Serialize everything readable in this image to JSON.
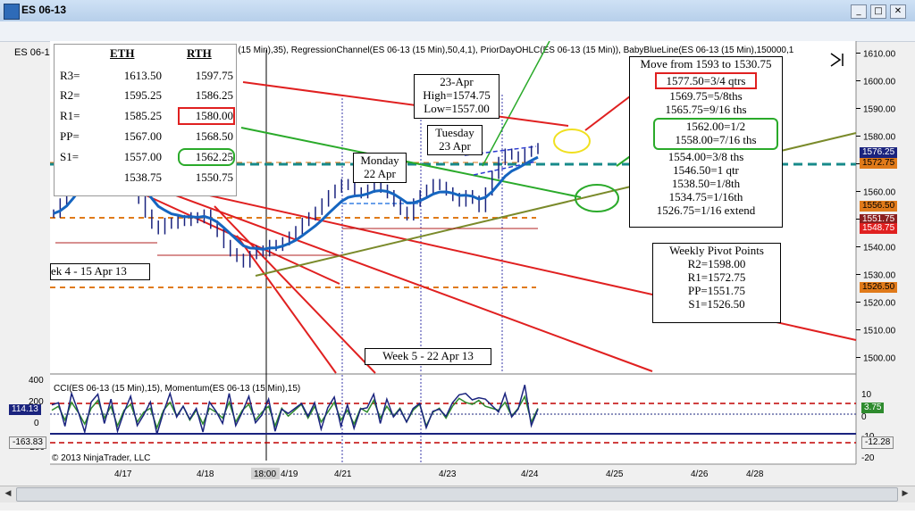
{
  "window": {
    "title": "ES 06-13",
    "instrument": "ES 06-1",
    "minimize_glyph": "_",
    "maximize_glyph": "□",
    "close_glyph": "✕"
  },
  "indicator_bar": {
    "text": "3 (15 Min),35), RegressionChannel(ES 06-13 (15 Min),50,4,1), PriorDayOHLC(ES 06-13 (15 Min)), BabyBlueLine(ES 06-13 (15 Min),150000,1"
  },
  "pivot_table": {
    "col_eth": "ETH",
    "col_rth": "RTH",
    "rows": [
      {
        "label": "R3=",
        "eth": "1613.50",
        "rth": "1597.75"
      },
      {
        "label": "R2=",
        "eth": "1595.25",
        "rth": "1586.25"
      },
      {
        "label": "R1=",
        "eth": "1585.25",
        "rth": "1580.00"
      },
      {
        "label": "PP=",
        "eth": "1567.00",
        "rth": "1568.50"
      },
      {
        "label": "S1=",
        "eth": "1557.00",
        "rth": "1562.25"
      },
      {
        "label": "",
        "eth": "1538.75",
        "rth": "1550.75"
      }
    ]
  },
  "annotations": {
    "apr23": [
      "23-Apr",
      "High=1574.75",
      "Low=1557.00"
    ],
    "tuesday": [
      "Tuesday",
      "23 Apr"
    ],
    "monday": [
      "Monday",
      "22 Apr"
    ],
    "week4": "ek 4 - 15 Apr 13",
    "week5": "Week 5 - 22 Apr 13",
    "move": {
      "title": "Move from 1593 to 1530.75",
      "lines": [
        "1577.50=3/4 qtrs",
        "1569.75=5/8ths",
        "1565.75=9/16 ths",
        "1562.00=1/2",
        "1558.00=7/16 ths",
        "1554.00=3/8 ths",
        "1546.50=1 qtr",
        "1538.50=1/8th",
        "1534.75=1/16th",
        "1526.75=1/16 extend"
      ]
    },
    "weekly_pivots": [
      "Weekly Pivot Points",
      "R2=1598.00",
      "R1=1572.75",
      "PP=1551.75",
      "S1=1526.50"
    ]
  },
  "price_tags": {
    "t1": "1576.25",
    "t2": "1572.75",
    "t3": "1556.50",
    "t4": "1551.75",
    "t5": "1548.75",
    "t6": "1526.50"
  },
  "lower_panel": {
    "label": "CCI(ES 06-13 (15 Min),15), Momentum(ES 06-13 (15 Min),15)",
    "copyright": "© 2013 NinjaTrader, LLC",
    "left_value_1": "114.13",
    "left_value_2": "-163.83",
    "right_value_1": "3.75",
    "right_value_2": "-12.28",
    "left_ticks": [
      "400",
      "200",
      "0",
      "-200"
    ],
    "right_ticks": [
      "10",
      "0",
      "-10",
      "-20"
    ]
  },
  "chart_data": {
    "type": "line",
    "y_axis_ticks": [
      1610,
      1600,
      1590,
      1580,
      1570,
      1560,
      1550,
      1540,
      1530,
      1520,
      1510,
      1500
    ],
    "ylim": [
      1495,
      1615
    ],
    "x_ticks": [
      "4/17",
      "4/18",
      "18:00",
      "4/19",
      "4/21",
      "4/23",
      "4/24",
      "4/25",
      "4/26",
      "4/28"
    ],
    "colors": {
      "price": "#1a237e",
      "ma": "#1565c0",
      "red_lines": "#e02020",
      "green_lines": "#2aaa2a",
      "olive": "#7a8a2a",
      "orange": "#e07a1a",
      "teal": "#178a8a"
    },
    "price_series": [
      [
        1552,
        1556,
        1560,
        1566,
        1570,
        1573,
        1571,
        1569,
        1572,
        1570,
        1567,
        1565,
        1561,
        1557,
        1552,
        1548,
        1546,
        1549,
        1548,
        1550,
        1549,
        1551,
        1550,
        1552,
        1548,
        1545,
        1541,
        1538,
        1536,
        1534,
        1537,
        1539,
        1538,
        1541,
        1540,
        1542,
        1544,
        1546,
        1549,
        1551,
        1553,
        1556,
        1559,
        1561,
        1563,
        1562,
        1560,
        1559,
        1561,
        1563,
        1561,
        1559,
        1556,
        1553,
        1551,
        1556,
        1559,
        1561,
        1563,
        1562,
        1560,
        1558,
        1556,
        1559,
        1557,
        1554,
        1560,
        1566,
        1571,
        1574,
        1573,
        1572,
        1574,
        1575,
        1576
      ]
    ],
    "momentum_series": [
      2,
      4,
      -3,
      6,
      1,
      -5,
      3,
      7,
      -2,
      4,
      -6,
      2,
      5,
      -4,
      1,
      3,
      -7,
      2,
      6,
      -1,
      4,
      -3,
      2,
      -5,
      3,
      1,
      -2,
      6,
      -4,
      2,
      5,
      -3,
      1,
      4,
      -6,
      3,
      -1,
      2,
      5,
      -2,
      4,
      -4,
      1,
      6,
      -3,
      2,
      -5,
      3,
      1,
      7,
      -2,
      4,
      -1,
      3,
      -4,
      2,
      5,
      -6,
      1,
      3,
      -2,
      4,
      8,
      6,
      5,
      7,
      4,
      3,
      2,
      6,
      -1,
      3,
      9,
      -4,
      3
    ]
  }
}
